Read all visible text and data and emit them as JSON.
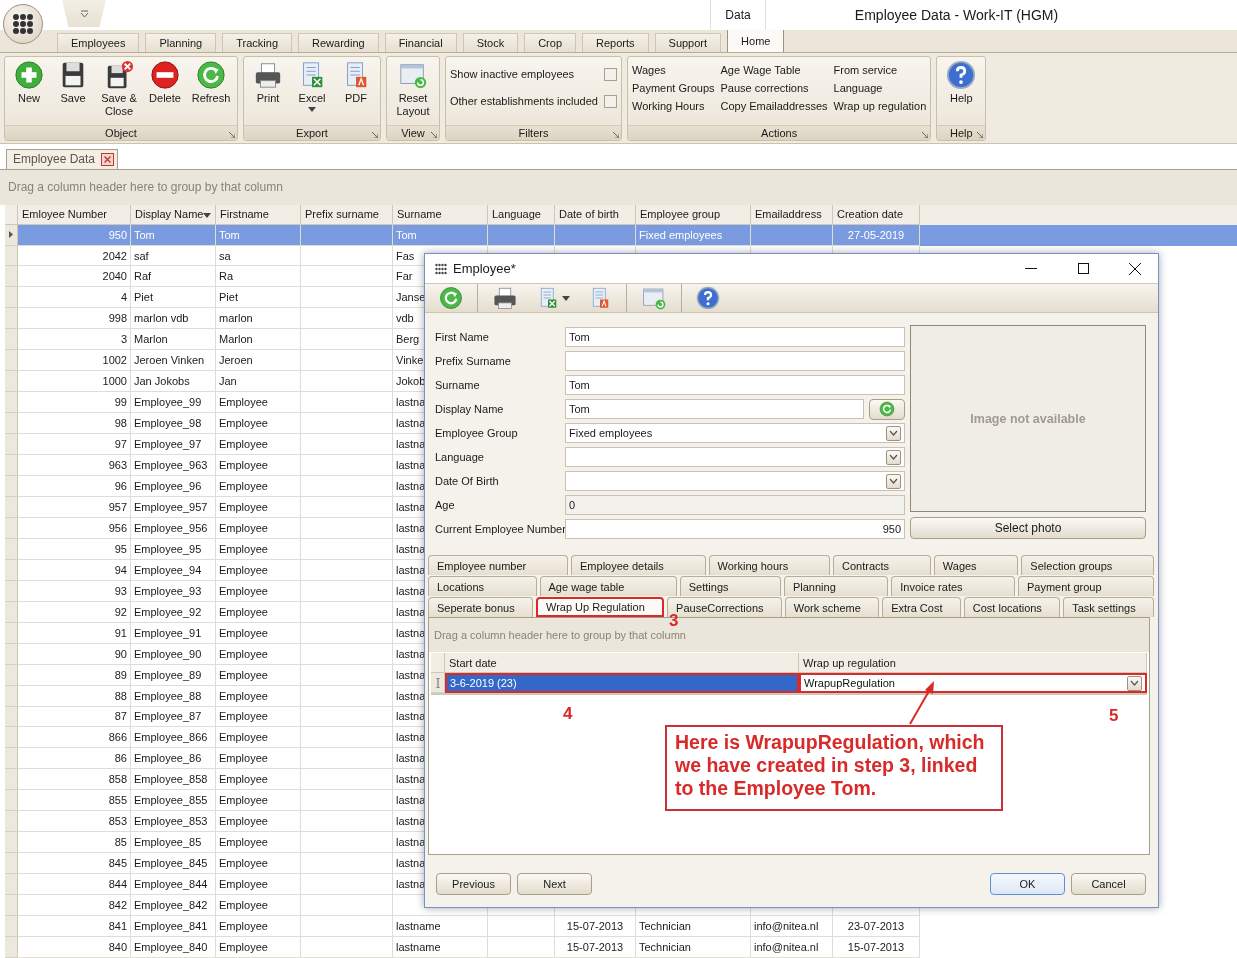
{
  "title": "Employee Data - Work-IT (HGM)",
  "context_tab_group": "Data",
  "ribbon_tabs": [
    {
      "label": "Employees",
      "selected": false
    },
    {
      "label": "Planning",
      "selected": false
    },
    {
      "label": "Tracking",
      "selected": false
    },
    {
      "label": "Rewarding",
      "selected": false
    },
    {
      "label": "Financial",
      "selected": false
    },
    {
      "label": "Stock",
      "selected": false
    },
    {
      "label": "Crop",
      "selected": false
    },
    {
      "label": "Reports",
      "selected": false
    },
    {
      "label": "Support",
      "selected": false
    },
    {
      "label": "Home",
      "selected": true
    }
  ],
  "ribbon_groups": [
    {
      "title": "Object",
      "kind": "buttons",
      "items": [
        {
          "label": "New"
        },
        {
          "label": "Save"
        },
        {
          "label": "Save & Close"
        },
        {
          "label": "Delete"
        },
        {
          "label": "Refresh"
        }
      ]
    },
    {
      "title": "Export",
      "kind": "buttons",
      "items": [
        {
          "label": "Print"
        },
        {
          "label": "Excel",
          "dropdown": true
        },
        {
          "label": "PDF"
        }
      ]
    },
    {
      "title": "View",
      "kind": "buttons",
      "items": [
        {
          "label": "Reset Layout"
        }
      ]
    },
    {
      "title": "Filters",
      "kind": "checks",
      "items": [
        {
          "label": "Show inactive employees",
          "checked": false
        },
        {
          "label": "Other establishments included",
          "checked": false
        }
      ]
    },
    {
      "title": "Actions",
      "kind": "links",
      "items": [
        {
          "label": "Wages"
        },
        {
          "label": "Age Wage Table"
        },
        {
          "label": "From service"
        },
        {
          "label": "Payment Groups"
        },
        {
          "label": "Pause corrections"
        },
        {
          "label": "Language"
        },
        {
          "label": "Working Hours"
        },
        {
          "label": "Copy Emailaddresses"
        },
        {
          "label": "Wrap up regulation"
        }
      ]
    },
    {
      "title": "Help",
      "kind": "buttons",
      "items": [
        {
          "label": "Help"
        }
      ]
    }
  ],
  "document_tabs": [
    {
      "label": "Employee Data",
      "selected": true
    }
  ],
  "group_hint": "Drag a column header here to group by that column",
  "columns": [
    {
      "label": "Emloyee Number",
      "sorted": false
    },
    {
      "label": "Display Name",
      "sorted": true
    },
    {
      "label": "Firstname",
      "sorted": false
    },
    {
      "label": "Prefix surname",
      "sorted": false
    },
    {
      "label": "Surname",
      "sorted": false
    },
    {
      "label": "Language",
      "sorted": false
    },
    {
      "label": "Date of birth",
      "sorted": false
    },
    {
      "label": "Employee group",
      "sorted": false
    },
    {
      "label": "Emailaddress",
      "sorted": false
    },
    {
      "label": "Creation date",
      "sorted": false
    }
  ],
  "rows": [
    {
      "selected": true,
      "number": "950",
      "display_name": "Tom",
      "firstname": "Tom",
      "surname": "Tom",
      "group": "Fixed employees",
      "created": "27-05-2019"
    },
    {
      "selected": false,
      "number": "2042",
      "display_name": "saf",
      "firstname": "sa",
      "surname": "Fas"
    },
    {
      "selected": false,
      "number": "2040",
      "display_name": "Raf",
      "firstname": "Ra",
      "surname": "Far"
    },
    {
      "selected": false,
      "number": "4",
      "display_name": "Piet",
      "firstname": "Piet",
      "surname": "Janse"
    },
    {
      "selected": false,
      "number": "998",
      "display_name": "marlon vdb",
      "firstname": "marlon",
      "surname": "vdb"
    },
    {
      "selected": false,
      "number": "3",
      "display_name": "Marlon",
      "firstname": "Marlon",
      "surname": "Berg"
    },
    {
      "selected": false,
      "number": "1002",
      "display_name": "Jeroen Vinken",
      "firstname": "Jeroen",
      "surname": "Vinke"
    },
    {
      "selected": false,
      "number": "1000",
      "display_name": "Jan Jokobs",
      "firstname": "Jan",
      "surname": "Jokob"
    },
    {
      "selected": false,
      "number": "99",
      "display_name": "Employee_99",
      "firstname": "Employee",
      "surname": "lastna"
    },
    {
      "selected": false,
      "number": "98",
      "display_name": "Employee_98",
      "firstname": "Employee",
      "surname": "lastna"
    },
    {
      "selected": false,
      "number": "97",
      "display_name": "Employee_97",
      "firstname": "Employee",
      "surname": "lastna"
    },
    {
      "selected": false,
      "number": "963",
      "display_name": "Employee_963",
      "firstname": "Employee",
      "surname": "lastna"
    },
    {
      "selected": false,
      "number": "96",
      "display_name": "Employee_96",
      "firstname": "Employee",
      "surname": "lastna"
    },
    {
      "selected": false,
      "number": "957",
      "display_name": "Employee_957",
      "firstname": "Employee",
      "surname": "lastna"
    },
    {
      "selected": false,
      "number": "956",
      "display_name": "Employee_956",
      "firstname": "Employee",
      "surname": "lastna"
    },
    {
      "selected": false,
      "number": "95",
      "display_name": "Employee_95",
      "firstname": "Employee",
      "surname": "lastna"
    },
    {
      "selected": false,
      "number": "94",
      "display_name": "Employee_94",
      "firstname": "Employee",
      "surname": "lastna"
    },
    {
      "selected": false,
      "number": "93",
      "display_name": "Employee_93",
      "firstname": "Employee",
      "surname": "lastna"
    },
    {
      "selected": false,
      "number": "92",
      "display_name": "Employee_92",
      "firstname": "Employee",
      "surname": "lastna"
    },
    {
      "selected": false,
      "number": "91",
      "display_name": "Employee_91",
      "firstname": "Employee",
      "surname": "lastna"
    },
    {
      "selected": false,
      "number": "90",
      "display_name": "Employee_90",
      "firstname": "Employee",
      "surname": "lastna"
    },
    {
      "selected": false,
      "number": "89",
      "display_name": "Employee_89",
      "firstname": "Employee",
      "surname": "lastna"
    },
    {
      "selected": false,
      "number": "88",
      "display_name": "Employee_88",
      "firstname": "Employee",
      "surname": "lastna"
    },
    {
      "selected": false,
      "number": "87",
      "display_name": "Employee_87",
      "firstname": "Employee",
      "surname": "lastna"
    },
    {
      "selected": false,
      "number": "866",
      "display_name": "Employee_866",
      "firstname": "Employee",
      "surname": "lastna"
    },
    {
      "selected": false,
      "number": "86",
      "display_name": "Employee_86",
      "firstname": "Employee",
      "surname": "lastna"
    },
    {
      "selected": false,
      "number": "858",
      "display_name": "Employee_858",
      "firstname": "Employee",
      "surname": "lastna"
    },
    {
      "selected": false,
      "number": "855",
      "display_name": "Employee_855",
      "firstname": "Employee",
      "surname": "lastna"
    },
    {
      "selected": false,
      "number": "853",
      "display_name": "Employee_853",
      "firstname": "Employee",
      "surname": "lastna"
    },
    {
      "selected": false,
      "number": "85",
      "display_name": "Employee_85",
      "firstname": "Employee",
      "surname": "lastna"
    },
    {
      "selected": false,
      "number": "845",
      "display_name": "Employee_845",
      "firstname": "Employee",
      "surname": "lastna"
    },
    {
      "selected": false,
      "number": "844",
      "display_name": "Employee_844",
      "firstname": "Employee",
      "surname": "lastna"
    },
    {
      "selected": false,
      "number": "842",
      "display_name": "Employee_842",
      "firstname": "Employee"
    },
    {
      "selected": false,
      "number": "841",
      "display_name": "Employee_841",
      "firstname": "Employee",
      "surname": "lastname",
      "dob": "15-07-2013",
      "group": "Technician",
      "email": "info@nitea.nl",
      "created": "23-07-2013"
    },
    {
      "selected": false,
      "number": "840",
      "display_name": "Employee_840",
      "firstname": "Employee",
      "surname": "lastname",
      "dob": "15-07-2013",
      "group": "Technician",
      "email": "info@nitea.nl",
      "created": "15-07-2013"
    }
  ],
  "dialog": {
    "title": "Employee*",
    "fields": [
      {
        "label": "First Name",
        "kind": "text",
        "value": "Tom"
      },
      {
        "label": "Prefix Surname",
        "kind": "text"
      },
      {
        "label": "Surname",
        "kind": "text",
        "value": "Tom"
      },
      {
        "label": "Display Name",
        "kind": "text_refresh",
        "value": "Tom"
      },
      {
        "label": "Employee Group",
        "kind": "dropdown",
        "value": "Fixed employees"
      },
      {
        "label": "Language",
        "kind": "dropdown"
      },
      {
        "label": "Date Of Birth",
        "kind": "dropdown"
      },
      {
        "label": "Age",
        "kind": "readonly",
        "value": "0"
      },
      {
        "label": "Current Employee Number",
        "kind": "number",
        "value": "950"
      }
    ],
    "photo": {
      "text": "Image not available",
      "button": "Select photo"
    },
    "tab_rows": [
      {
        "tabs": [
          {
            "label": "Employee number",
            "selected": false,
            "highlighted": false
          },
          {
            "label": "Employee details",
            "selected": false,
            "highlighted": false
          },
          {
            "label": "Working hours",
            "selected": false,
            "highlighted": false
          },
          {
            "label": "Contracts",
            "selected": false,
            "highlighted": false
          },
          {
            "label": "Wages",
            "selected": false,
            "highlighted": false
          },
          {
            "label": "Selection groups",
            "selected": false,
            "highlighted": false
          }
        ]
      },
      {
        "tabs": [
          {
            "label": "Locations",
            "selected": false,
            "highlighted": false
          },
          {
            "label": "Age wage table",
            "selected": false,
            "highlighted": false
          },
          {
            "label": "Settings",
            "selected": false,
            "highlighted": false
          },
          {
            "label": "Planning",
            "selected": false,
            "highlighted": false
          },
          {
            "label": "Invoice rates",
            "selected": false,
            "highlighted": false
          },
          {
            "label": "Payment group",
            "selected": false,
            "highlighted": false
          }
        ]
      },
      {
        "tabs": [
          {
            "label": "Seperate bonus",
            "selected": false,
            "highlighted": false
          },
          {
            "label": "Wrap Up Regulation",
            "selected": true,
            "highlighted": true
          },
          {
            "label": "PauseCorrections",
            "selected": false,
            "highlighted": false
          },
          {
            "label": "Work scheme",
            "selected": false,
            "highlighted": false
          },
          {
            "label": "Extra Cost",
            "selected": false,
            "highlighted": false
          },
          {
            "label": "Cost locations",
            "selected": false,
            "highlighted": false
          },
          {
            "label": "Task settings",
            "selected": false,
            "highlighted": false
          }
        ]
      }
    ],
    "group_hint": "Drag a column header here to group by that column",
    "grid": {
      "columns": [
        "Start date",
        "Wrap up regulation"
      ],
      "rows": [
        {
          "start_date": "3-6-2019 (23)",
          "wrap_up_regulation": "WrapupRegulation",
          "selected": true,
          "highlighted": true
        }
      ]
    },
    "annotations": {
      "markers": [
        "3",
        "4",
        "5"
      ],
      "callout": "Here is WrapupRegulation, which we have created in step 3, linked to the Employee Tom."
    },
    "nav_buttons": [
      "Previous",
      "Next"
    ],
    "action_buttons": [
      {
        "label": "OK",
        "default": true
      },
      {
        "label": "Cancel",
        "default": false
      }
    ]
  }
}
